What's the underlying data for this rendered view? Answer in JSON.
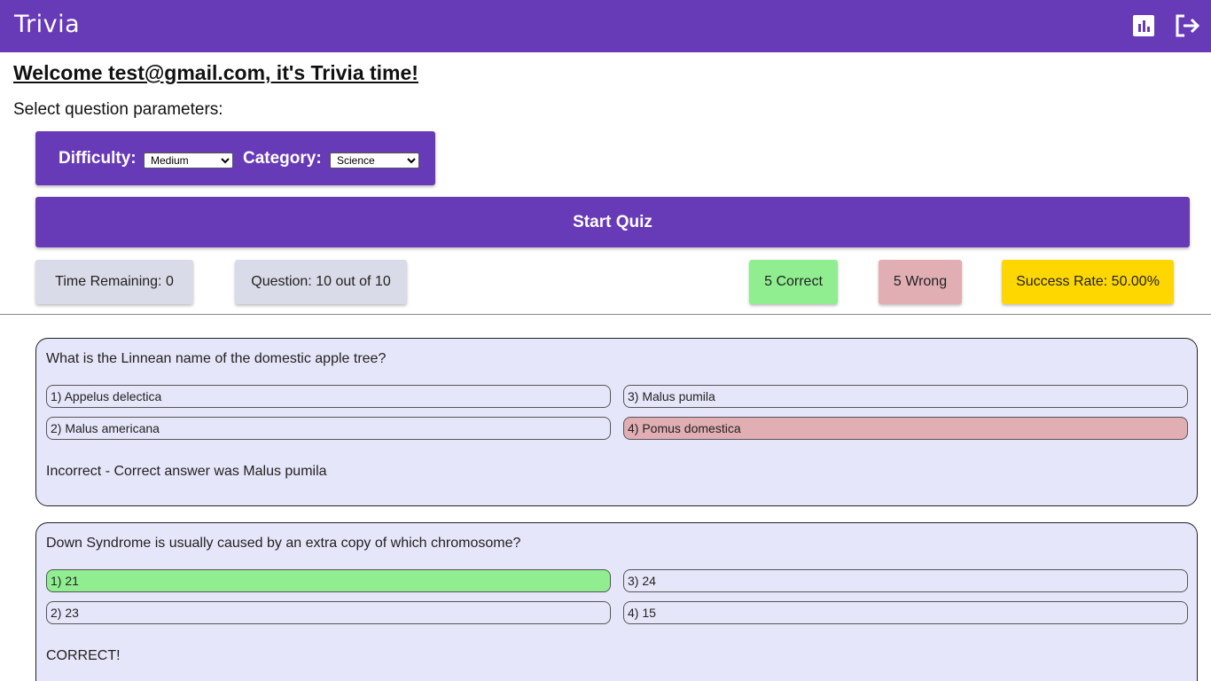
{
  "header": {
    "title": "Trivia",
    "stats_icon": "bar-chart-icon",
    "logout_icon": "logout-icon"
  },
  "welcome": "Welcome test@gmail.com, it's Trivia time!",
  "select_params_label": "Select question parameters:",
  "params": {
    "difficulty_label": "Difficulty:",
    "difficulty_value": "Medium",
    "category_label": "Category:",
    "category_value": "Science"
  },
  "start_button": "Start Quiz",
  "stats": {
    "time_remaining": "Time Remaining: 0",
    "question": "Question: 10 out of 10",
    "correct": "5 Correct",
    "wrong": "5 Wrong",
    "success_rate": "Success Rate: 50.00%"
  },
  "questions": [
    {
      "text": "What is the Linnean name of the domestic apple tree?",
      "answers": [
        "1) Appelus delectica",
        "2) Malus americana",
        "3) Malus pumila",
        "4) Pomus domestica"
      ],
      "feedback": "Incorrect - Correct answer was Malus pumila"
    },
    {
      "text": "Down Syndrome is usually caused by an extra copy of which chromosome?",
      "answers": [
        "1) 21",
        "2) 23",
        "3) 24",
        "4) 15"
      ],
      "feedback": "CORRECT!"
    }
  ],
  "colors": {
    "primary": "#673ab7",
    "card_bg": "#e6e6fa",
    "correct": "#90ee90",
    "wrong": "#e0aeb3",
    "rate": "#ffd700",
    "neutral_stat": "#dadbe8"
  }
}
